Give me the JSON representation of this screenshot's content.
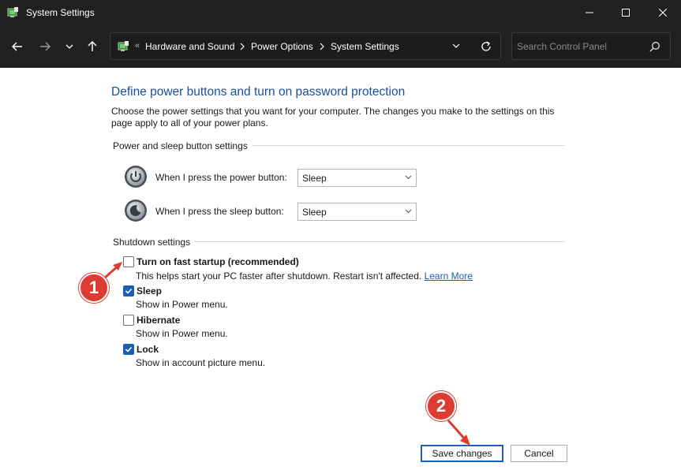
{
  "window": {
    "title": "System Settings"
  },
  "address_bar": {
    "breadcrumbs": [
      "Hardware and Sound",
      "Power Options",
      "System Settings"
    ],
    "search_placeholder": "Search Control Panel"
  },
  "page": {
    "heading": "Define power buttons and turn on password protection",
    "description": "Choose the power settings that you want for your computer. The changes you make to the settings on this page apply to all of your power plans."
  },
  "power_sleep_group": {
    "label": "Power and sleep button settings",
    "rows": [
      {
        "label": "When I press the power button:",
        "value": "Sleep",
        "icon": "power-button-icon"
      },
      {
        "label": "When I press the sleep button:",
        "value": "Sleep",
        "icon": "sleep-button-icon"
      }
    ]
  },
  "shutdown_group": {
    "label": "Shutdown settings",
    "options": [
      {
        "title": "Turn on fast startup (recommended)",
        "description": "This helps start your PC faster after shutdown. Restart isn't affected.",
        "link": "Learn More",
        "checked": false
      },
      {
        "title": "Sleep",
        "description": "Show in Power menu.",
        "checked": true
      },
      {
        "title": "Hibernate",
        "description": "Show in Power menu.",
        "checked": false
      },
      {
        "title": "Lock",
        "description": "Show in account picture menu.",
        "checked": true
      }
    ]
  },
  "annotations": {
    "step1": "1",
    "step2": "2",
    "color": "#dd3c32"
  },
  "buttons": {
    "save": "Save changes",
    "cancel": "Cancel"
  },
  "colors": {
    "titlebar": "#202020",
    "heading": "#1a4f9c",
    "link": "#1a5fb4",
    "checkbox_checked": "#1a5fb4"
  }
}
